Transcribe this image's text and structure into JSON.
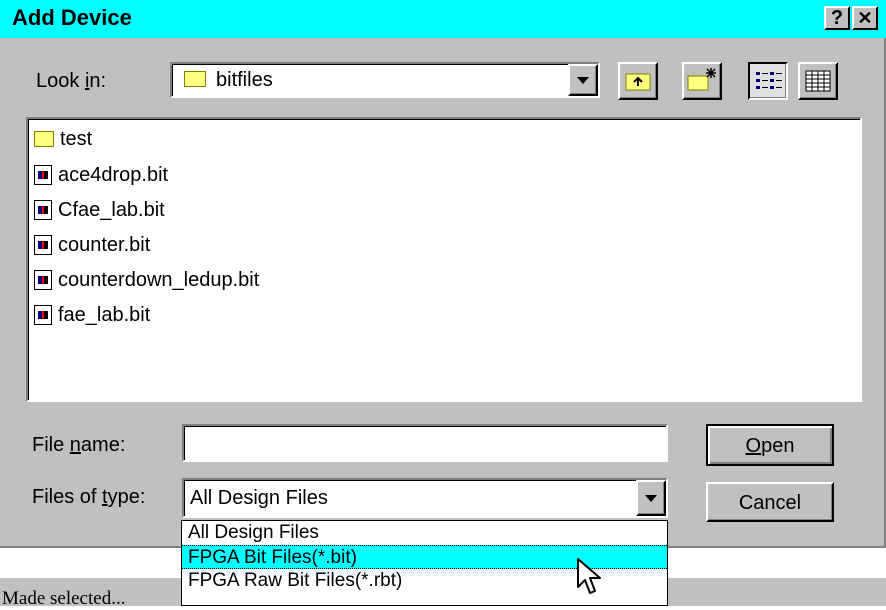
{
  "window": {
    "title": "Add Device",
    "help_button": "?",
    "close_button": "✕"
  },
  "look_in": {
    "label_prefix": "Look ",
    "label_accel": "i",
    "label_suffix": "n:",
    "value": "bitfiles"
  },
  "files": [
    {
      "name": "test",
      "icon": "folder-icon"
    },
    {
      "name": "ace4drop.bit",
      "icon": "bit-file-icon"
    },
    {
      "name": "Cfae_lab.bit",
      "icon": "bit-file-icon"
    },
    {
      "name": "counter.bit",
      "icon": "bit-file-icon"
    },
    {
      "name": "counterdown_ledup.bit",
      "icon": "bit-file-icon"
    },
    {
      "name": "fae_lab.bit",
      "icon": "bit-file-icon"
    }
  ],
  "file_name": {
    "label_prefix": "File ",
    "label_accel": "n",
    "label_suffix": "ame:",
    "value": ""
  },
  "files_of_type": {
    "label_prefix": "Files of ",
    "label_accel": "t",
    "label_suffix": "ype:",
    "value": "All Design Files",
    "options": [
      "All Design Files",
      "FPGA Bit Files(*.bit)",
      "FPGA Raw Bit Files(*.rbt)"
    ],
    "highlighted_index": 1
  },
  "buttons": {
    "open_accel": "O",
    "open_rest": "pen",
    "cancel": "Cancel"
  },
  "background_text": "Made selected...",
  "colors": {
    "titlebar": "#00ffff",
    "face": "#c0c0c0",
    "highlight": "#00ffff"
  }
}
